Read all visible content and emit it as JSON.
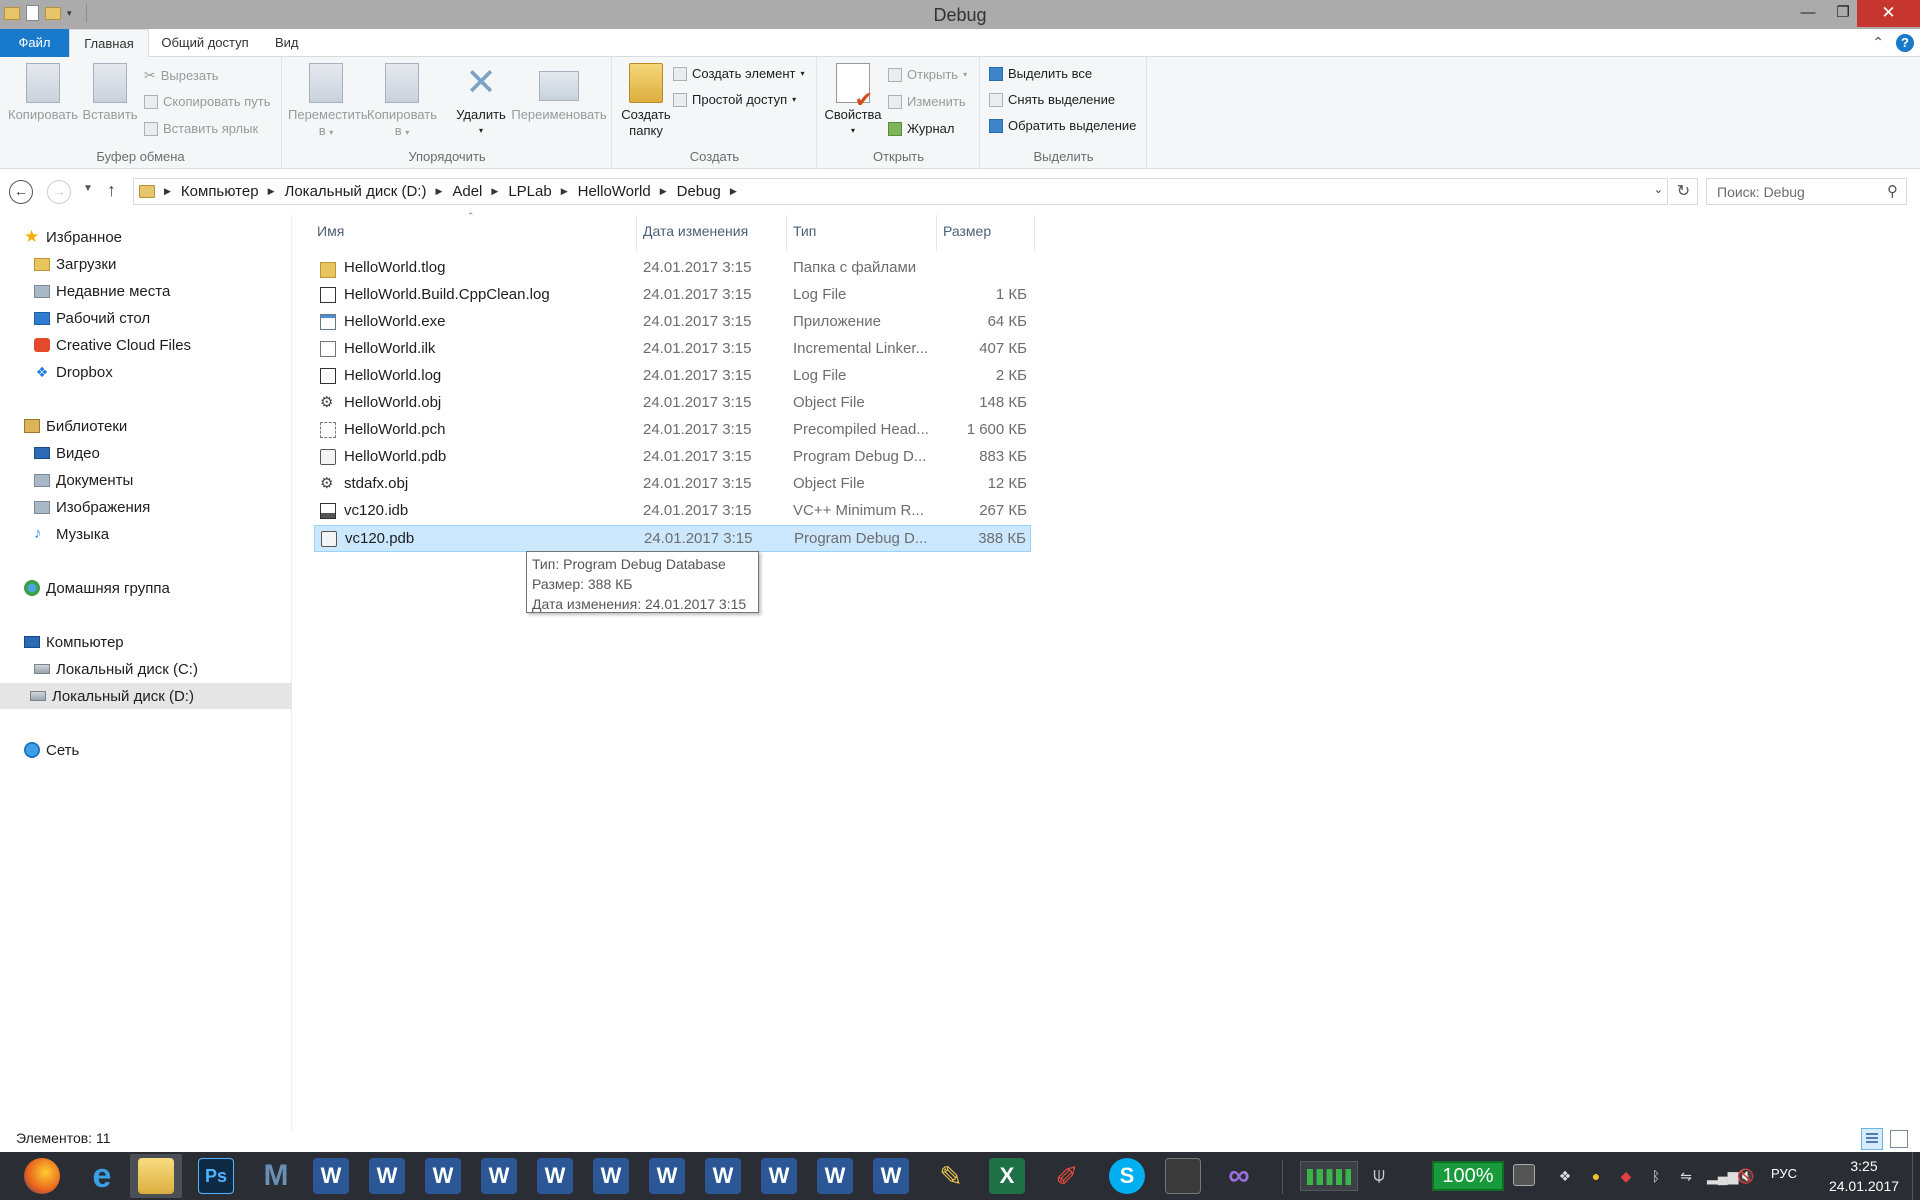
{
  "window": {
    "title": "Debug"
  },
  "ribbon_tabs": [
    {
      "label": "Файл"
    },
    {
      "label": "Главная"
    },
    {
      "label": "Общий доступ"
    },
    {
      "label": "Вид"
    }
  ],
  "ribbon": {
    "clipboard": {
      "label": "Буфер обмена",
      "copy": "Копировать",
      "paste": "Вставить",
      "cut": "Вырезать",
      "copy_path": "Скопировать путь",
      "paste_shortcut": "Вставить ярлык"
    },
    "organize": {
      "label": "Упорядочить",
      "move_line1": "Переместить",
      "move_line2": "в",
      "copy_line1": "Копировать",
      "copy_line2": "в",
      "delete": "Удалить",
      "rename": "Переименовать"
    },
    "create": {
      "label": "Создать",
      "new_folder_line1": "Создать",
      "new_folder_line2": "папку",
      "new_item": "Создать элемент",
      "easy_access": "Простой доступ"
    },
    "open": {
      "label": "Открыть",
      "properties": "Свойства",
      "open": "Открыть",
      "edit": "Изменить",
      "history": "Журнал"
    },
    "select": {
      "label": "Выделить",
      "select_all": "Выделить все",
      "select_none": "Снять выделение",
      "invert": "Обратить выделение"
    }
  },
  "address": {
    "crumbs": [
      "Компьютер",
      "Локальный диск (D:)",
      "Adel",
      "LPLab",
      "HelloWorld",
      "Debug"
    ],
    "search_placeholder": "Поиск: Debug"
  },
  "nav": {
    "favorites": "Избранное",
    "downloads": "Загрузки",
    "recent": "Недавние места",
    "desktop": "Рабочий стол",
    "creative_cloud": "Creative Cloud Files",
    "dropbox": "Dropbox",
    "libraries": "Библиотеки",
    "video": "Видео",
    "documents": "Документы",
    "images": "Изображения",
    "music": "Музыка",
    "homegroup": "Домашняя группа",
    "computer": "Компьютер",
    "disk_c": "Локальный диск (C:)",
    "disk_d": "Локальный диск (D:)",
    "network": "Сеть"
  },
  "columns": {
    "name": "Имя",
    "date": "Дата изменения",
    "type": "Тип",
    "size": "Размер"
  },
  "files": [
    {
      "name": "HelloWorld.tlog",
      "date": "24.01.2017 3:15",
      "type": "Папка с файлами",
      "size": "",
      "icon": "folder-icon"
    },
    {
      "name": "HelloWorld.Build.CppClean.log",
      "date": "24.01.2017 3:15",
      "type": "Log File",
      "size": "1 КБ",
      "icon": "log-file-icon"
    },
    {
      "name": "HelloWorld.exe",
      "date": "24.01.2017 3:15",
      "type": "Приложение",
      "size": "64 КБ",
      "icon": "exe-file-icon"
    },
    {
      "name": "HelloWorld.ilk",
      "date": "24.01.2017 3:15",
      "type": "Incremental Linker...",
      "size": "407 КБ",
      "icon": "generic-file-icon"
    },
    {
      "name": "HelloWorld.log",
      "date": "24.01.2017 3:15",
      "type": "Log File",
      "size": "2 КБ",
      "icon": "log-file-icon"
    },
    {
      "name": "HelloWorld.obj",
      "date": "24.01.2017 3:15",
      "type": "Object File",
      "size": "148 КБ",
      "icon": "obj-file-icon"
    },
    {
      "name": "HelloWorld.pch",
      "date": "24.01.2017 3:15",
      "type": "Precompiled Head...",
      "size": "1 600 КБ",
      "icon": "pch-file-icon"
    },
    {
      "name": "HelloWorld.pdb",
      "date": "24.01.2017 3:15",
      "type": "Program Debug D...",
      "size": "883 КБ",
      "icon": "pdb-file-icon"
    },
    {
      "name": "stdafx.obj",
      "date": "24.01.2017 3:15",
      "type": "Object File",
      "size": "12 КБ",
      "icon": "obj-file-icon"
    },
    {
      "name": "vc120.idb",
      "date": "24.01.2017 3:15",
      "type": "VC++ Minimum R...",
      "size": "267 КБ",
      "icon": "idb-file-icon"
    },
    {
      "name": "vc120.pdb",
      "date": "24.01.2017 3:15",
      "type": "Program Debug D...",
      "size": "388 КБ",
      "icon": "pdb-file-icon",
      "selected": true
    }
  ],
  "tooltip": {
    "line1": "Тип: Program Debug Database",
    "line2": "Размер: 388 КБ",
    "line3": "Дата изменения: 24.01.2017 3:15"
  },
  "status": {
    "items": "Элементов: 11"
  },
  "taskbar": {
    "battery": "100%",
    "lang": "РУС",
    "time": "3:25",
    "date": "24.01.2017"
  }
}
